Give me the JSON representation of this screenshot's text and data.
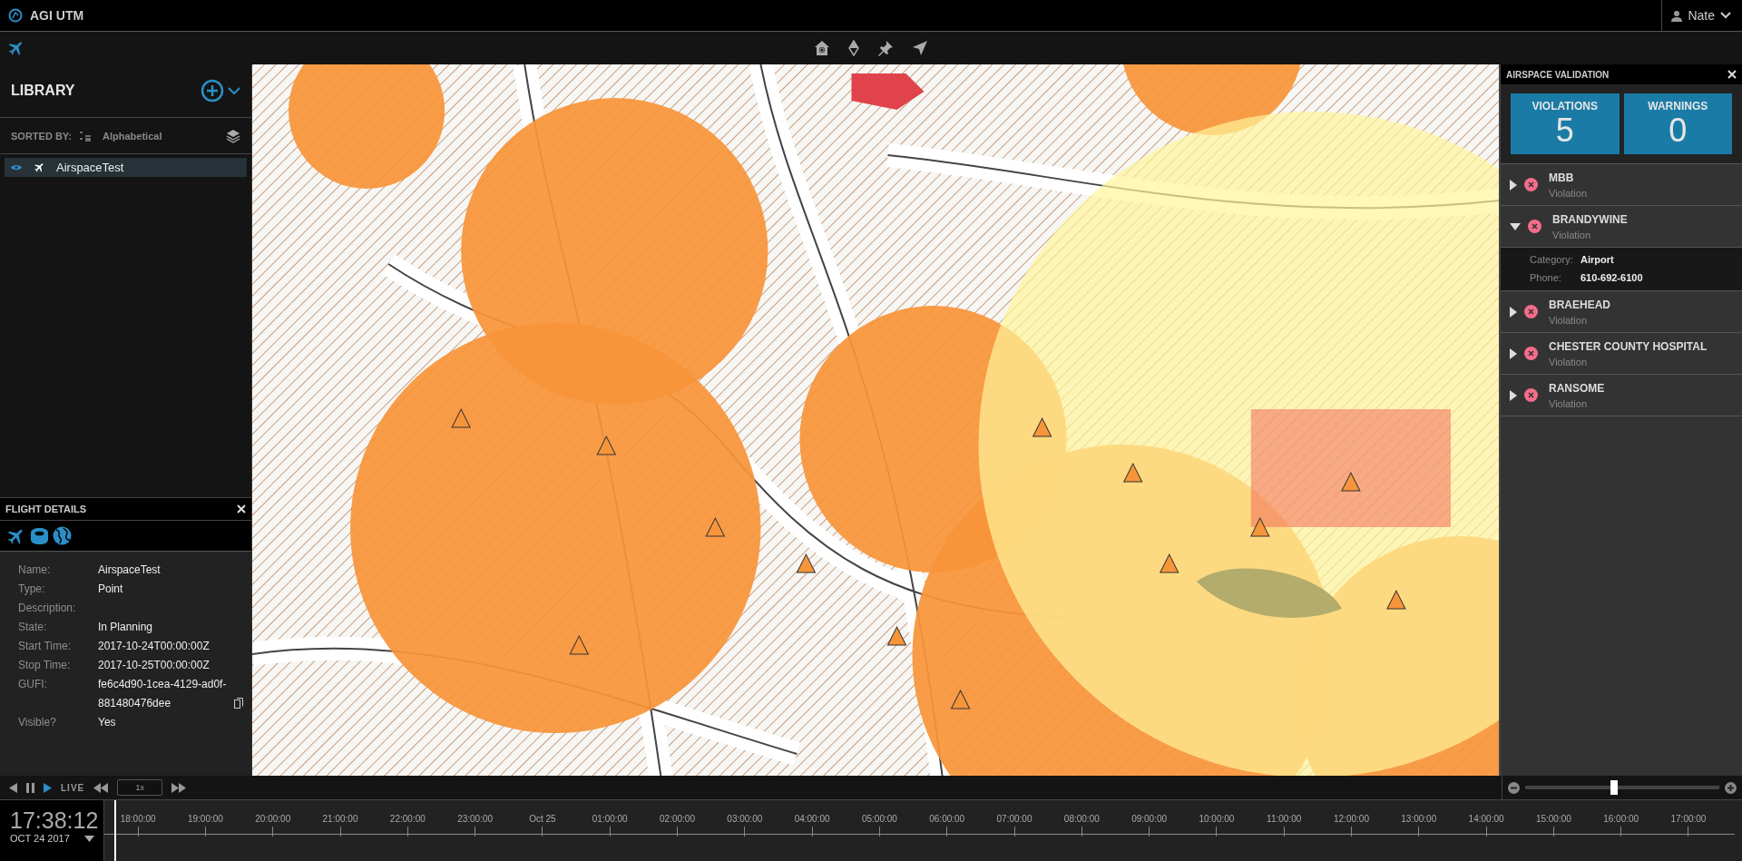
{
  "app_bar": {
    "title": "AGI UTM",
    "user": "Nate"
  },
  "library": {
    "title": "LIBRARY",
    "sorted_by_label": "SORTED BY:",
    "sort_value": "Alphabetical",
    "items": [
      {
        "label": "AirspaceTest",
        "visible": true,
        "selected": true
      }
    ]
  },
  "flight_details": {
    "title": "FLIGHT DETAILS",
    "fields": [
      {
        "label": "Name:",
        "value": "AirspaceTest"
      },
      {
        "label": "Type:",
        "value": "Point"
      },
      {
        "label": "Description:"
      },
      {
        "label": "State:",
        "value": "In Planning"
      },
      {
        "label": "Start Time:",
        "value": "2017-10-24T00:00:00Z"
      },
      {
        "label": "Stop Time:",
        "value": "2017-10-25T00:00:00Z"
      },
      {
        "label": "GUFI:",
        "value": "fe6c4d90-1cea-4129-ad0f-881480476dee",
        "copyable": true
      },
      {
        "label": "Visible?",
        "value": "Yes"
      }
    ]
  },
  "validation": {
    "title": "AIRSPACE VALIDATION",
    "counters": [
      {
        "label": "VIOLATIONS",
        "value": "5"
      },
      {
        "label": "WARNINGS",
        "value": "0"
      }
    ],
    "items": [
      {
        "name": "MBB",
        "status": "Violation",
        "expanded": false
      },
      {
        "name": "BRANDYWINE",
        "status": "Violation",
        "expanded": true,
        "details": [
          {
            "label": "Category:",
            "value": "Airport"
          },
          {
            "label": "Phone:",
            "value": "610-692-6100"
          }
        ]
      },
      {
        "name": "BRAEHEAD",
        "status": "Violation",
        "expanded": false
      },
      {
        "name": "CHESTER COUNTY HOSPITAL",
        "status": "Violation",
        "expanded": false
      },
      {
        "name": "RANSOME",
        "status": "Violation",
        "expanded": false
      }
    ]
  },
  "playback": {
    "live_label": "LIVE",
    "speed": "1x",
    "playing": true
  },
  "zoom": {
    "level": 0.46
  },
  "clock": {
    "time": "17:38:12",
    "date": "OCT 24 2017"
  },
  "timeline": {
    "ticks": [
      "18:00:00",
      "19:00:00",
      "20:00:00",
      "21:00:00",
      "22:00:00",
      "23:00:00",
      "Oct 25",
      "01:00:00",
      "02:00:00",
      "03:00:00",
      "04:00:00",
      "05:00:00",
      "06:00:00",
      "07:00:00",
      "08:00:00",
      "09:00:00",
      "10:00:00",
      "11:00:00",
      "12:00:00",
      "13:00:00",
      "14:00:00",
      "15:00:00",
      "16:00:00",
      "17:00:00"
    ]
  }
}
